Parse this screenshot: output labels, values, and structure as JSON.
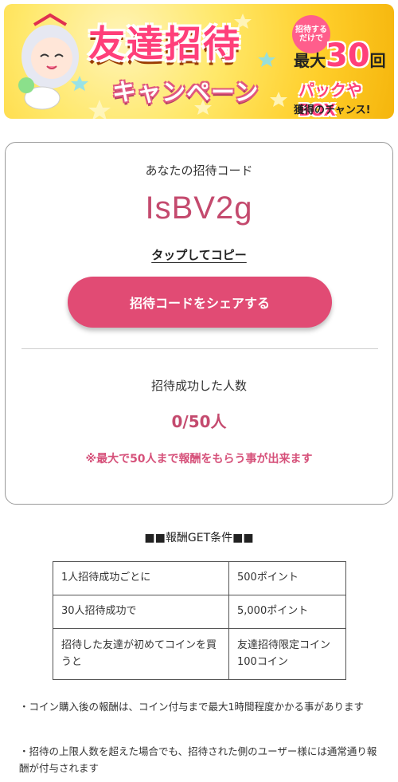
{
  "banner": {
    "title": "友達招待",
    "subtitle": "キャンペーン",
    "bubble": "招待するだけで",
    "max_prefix": "最大",
    "max_number": "30",
    "max_suffix": "回",
    "pack_box": "パックやBOX",
    "chance": "獲得のチャンス!"
  },
  "card": {
    "code_label": "あなたの招待コード",
    "invite_code": "IsBV2g",
    "copy_text": "タップしてコピー",
    "share_button": "招待コードをシェアする",
    "count_label": "招待成功した人数",
    "count_value": "0/50人",
    "note": "※最大で50人まで報酬をもらう事が出来ます"
  },
  "conditions": {
    "title": "■■報酬GET条件■■",
    "rows": [
      {
        "condition": "1人招待成功ごとに",
        "reward": "500ポイント"
      },
      {
        "condition": "30人招待成功で",
        "reward": "5,000ポイント"
      },
      {
        "condition": "招待した友達が初めてコインを買うと",
        "reward": "友達招待限定コイン100コイン"
      }
    ]
  },
  "footnotes": [
    "・コイン購入後の報酬は、コイン付与まで最大1時間程度かかる事があります",
    "・招待の上限人数を超えた場合でも、招待された側のユーザー様には通常通り報酬が付与されます"
  ],
  "colors": {
    "accent": "#e14b74",
    "code_text": "#c44a6e",
    "banner_bg": "#ffd93a"
  }
}
